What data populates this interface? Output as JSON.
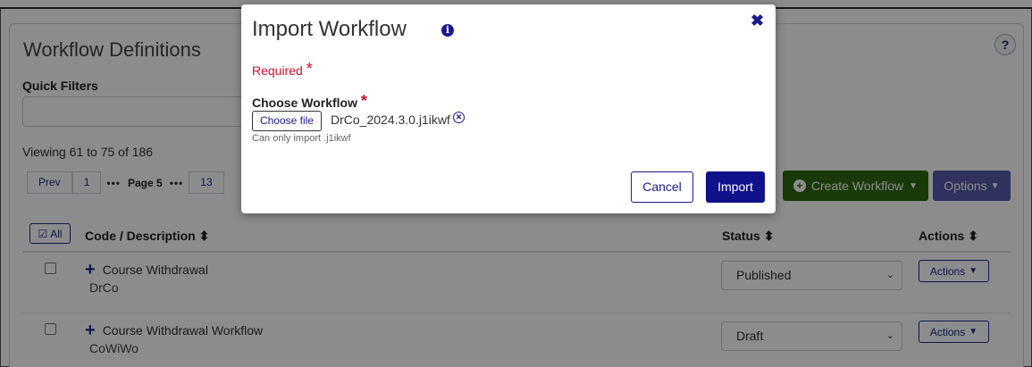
{
  "page": {
    "title": "Workflow Definitions",
    "help_icon": "?",
    "quick_filters_label": "Quick Filters",
    "viewing_text": "Viewing 61 to 75 of 186"
  },
  "pagination": {
    "prev": "Prev",
    "first": "1",
    "dots": "•••",
    "current": "Page 5",
    "last": "13"
  },
  "toolbar": {
    "create_label": "Create Workflow",
    "options_label": "Options",
    "create_color": "#2f6b0f",
    "options_color": "#5a5aaa"
  },
  "table": {
    "all_label": "All",
    "col_code": "Code / Description",
    "col_status": "Status",
    "col_actions": "Actions",
    "sort_glyph": "⬍",
    "rows": [
      {
        "title": "Course Withdrawal",
        "code": "DrCo",
        "status": "Published",
        "actions": "Actions"
      },
      {
        "title": "Course Withdrawal Workflow",
        "code": "CoWiWo",
        "status": "Draft",
        "actions": "Actions"
      }
    ]
  },
  "modal": {
    "title": "Import Workflow",
    "info_icon": "i",
    "close_icon": "✖",
    "required_label": "Required",
    "required_star": "*",
    "choose_label": "Choose Workflow",
    "file_button": "Choose file",
    "file_name": "DrCo_2024.3.0.j1ikwf",
    "remove_icon": "✕",
    "hint": "Can only import .j1ikwf",
    "cancel_label": "Cancel",
    "import_label": "Import",
    "accent_color": "#11118c",
    "required_color": "#c8102e"
  }
}
